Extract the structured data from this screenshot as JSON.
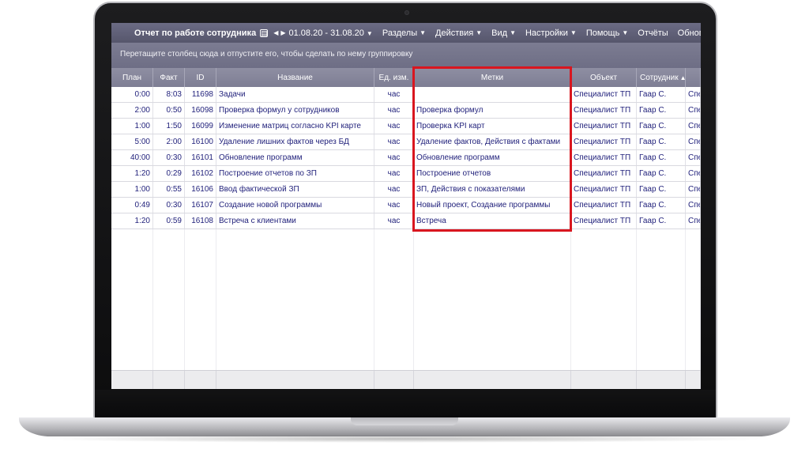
{
  "toolbar": {
    "title": "Отчет по работе сотрудника",
    "date_range": "01.08.20 - 31.08.20",
    "menus": [
      {
        "label": "Разделы",
        "has_dropdown": true
      },
      {
        "label": "Действия",
        "has_dropdown": true
      },
      {
        "label": "Вид",
        "has_dropdown": true
      },
      {
        "label": "Настройки",
        "has_dropdown": true
      },
      {
        "label": "Помощь",
        "has_dropdown": true
      },
      {
        "label": "Отчёты",
        "has_dropdown": false
      },
      {
        "label": "Обновить отчет",
        "has_dropdown": false
      }
    ]
  },
  "group_hint": "Перетащите столбец сюда и отпустите его, чтобы сделать по нему группировку",
  "columns": {
    "plan": "План",
    "fakt": "Факт",
    "id": "ID",
    "name": "Название",
    "unit": "Ед. изм.",
    "tags": "Метки",
    "object": "Объект",
    "employee": "Сотрудник"
  },
  "rows": [
    {
      "plan": "0:00",
      "fakt": "8:03",
      "id": "11698",
      "name": "Задачи",
      "unit": "час",
      "tags": "",
      "object": "Специалист ТП",
      "employee": "Гаар С.",
      "more": "Спе"
    },
    {
      "plan": "2:00",
      "fakt": "0:50",
      "id": "16098",
      "name": "Проверка формул у сотрудников",
      "unit": "час",
      "tags": "Проверка формул",
      "object": "Специалист ТП",
      "employee": "Гаар С.",
      "more": "Спе"
    },
    {
      "plan": "1:00",
      "fakt": "1:50",
      "id": "16099",
      "name": "Изменение матриц согласно KPI карте",
      "unit": "час",
      "tags": "Проверка KPI карт",
      "object": "Специалист ТП",
      "employee": "Гаар С.",
      "more": "Спе"
    },
    {
      "plan": "5:00",
      "fakt": "2:00",
      "id": "16100",
      "name": "Удаление лишних фактов через БД",
      "unit": "час",
      "tags": "Удаление фактов, Действия с фактами",
      "object": "Специалист ТП",
      "employee": "Гаар С.",
      "more": "Спе"
    },
    {
      "plan": "40:00",
      "fakt": "0:30",
      "id": "16101",
      "name": "Обновление программ",
      "unit": "час",
      "tags": "Обновление программ",
      "object": "Специалист ТП",
      "employee": "Гаар С.",
      "more": "Спе"
    },
    {
      "plan": "1:20",
      "fakt": "0:29",
      "id": "16102",
      "name": "Построение отчетов по ЗП",
      "unit": "час",
      "tags": "Построение отчетов",
      "object": "Специалист ТП",
      "employee": "Гаар С.",
      "more": "Спе"
    },
    {
      "plan": "1:00",
      "fakt": "0:55",
      "id": "16106",
      "name": "Ввод фактической ЗП",
      "unit": "час",
      "tags": "ЗП, Действия с показателями",
      "object": "Специалист ТП",
      "employee": "Гаар С.",
      "more": "Спе"
    },
    {
      "plan": "0:49",
      "fakt": "0:30",
      "id": "16107",
      "name": "Создание новой программы",
      "unit": "час",
      "tags": "Новый проект, Создание программы",
      "object": "Специалист ТП",
      "employee": "Гаар С.",
      "more": "Спе"
    },
    {
      "plan": "1:20",
      "fakt": "0:59",
      "id": "16108",
      "name": "Встреча с клиентами",
      "unit": "час",
      "tags": "Встреча",
      "object": "Специалист ТП",
      "employee": "Гаар С.",
      "more": "Спе"
    }
  ],
  "colors": {
    "toolbar_bg": "#5f5f76",
    "header_bg": "#8585 9a",
    "link_text": "#1f1f7a",
    "highlight_border": "#d9161f"
  },
  "icons": {
    "report_icon": "calendar-icon",
    "prev": "chevron-left-icon",
    "next": "chevron-right-icon",
    "dropdown": "chevron-down-icon",
    "sort": "sort-asc-icon"
  }
}
